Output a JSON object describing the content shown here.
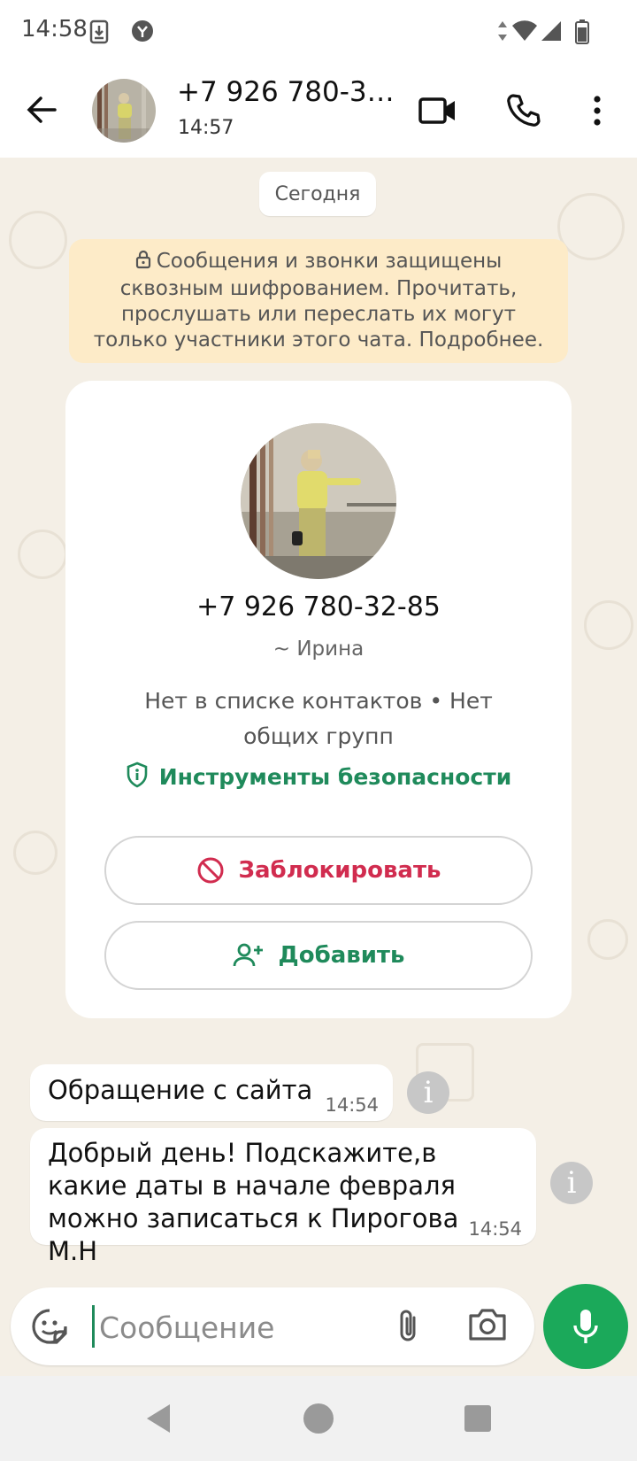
{
  "status_bar": {
    "time": "14:58"
  },
  "header": {
    "title": "+7 926 780-32-85",
    "subtitle": "14:57"
  },
  "chat": {
    "date_chip": "Сегодня",
    "encryption_notice": "Сообщения и звонки защищены сквозным шифрованием. Прочитать, прослушать или переслать их могут только участники этого чата. Подробнее."
  },
  "contact_card": {
    "phone": "+7 926 780-32-85",
    "name": "~ Ирина",
    "info": "Нет в списке контактов • Нет общих групп",
    "safety_tools": "Инструменты безопасности",
    "block_label": "Заблокировать",
    "add_label": "Добавить"
  },
  "messages": [
    {
      "text": "Обращение с сайта",
      "time": "14:54"
    },
    {
      "text": "Добрый день! Подскажите,в какие даты в начале февраля можно записаться к Пирогова М.Н",
      "time": "14:54"
    }
  ],
  "composer": {
    "placeholder": "Сообщение"
  },
  "colors": {
    "accent_green": "#1f8a5b",
    "mic_green": "#1ba95a",
    "danger_red": "#d12c4f",
    "chat_bg": "#f4efe6",
    "encryption_bg": "#fdebc8"
  },
  "icons": [
    "back-arrow-icon",
    "video-call-icon",
    "phone-icon",
    "more-vert-icon",
    "lock-icon",
    "shield-icon",
    "block-icon",
    "add-person-icon",
    "info-icon",
    "emoji-sticker-icon",
    "attach-icon",
    "camera-icon",
    "mic-icon"
  ]
}
